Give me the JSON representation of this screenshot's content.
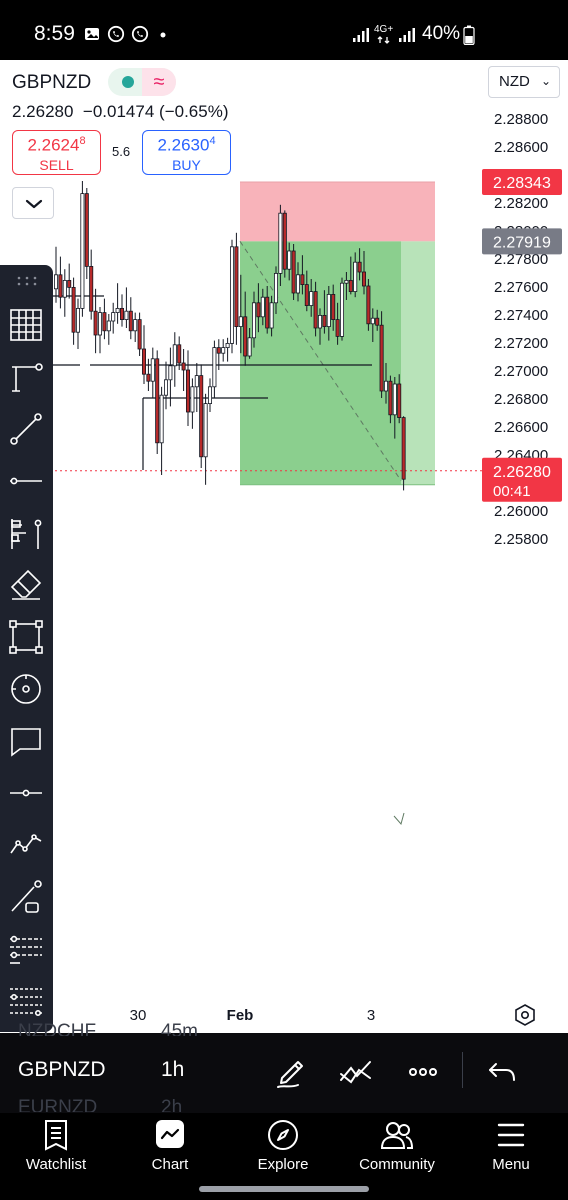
{
  "status_bar": {
    "time": "8:59",
    "network": "4G+",
    "battery": "40%",
    "icons": [
      "gallery-icon",
      "whatsapp-icon",
      "whatsapp-icon",
      "dot-icon",
      "signal-icon",
      "signal-icon",
      "battery-icon"
    ]
  },
  "header": {
    "symbol": "GBPNZD",
    "price": "2.26280",
    "change": "−0.01474",
    "change_pct": "(−0.65%)",
    "sell": {
      "price": "2.2624",
      "price_sup": "8",
      "label": "SELL"
    },
    "buy": {
      "price": "2.2630",
      "price_sup": "4",
      "label": "BUY"
    },
    "spread": "5.6",
    "currency": "NZD"
  },
  "chart_data": {
    "type": "candlestick",
    "price_axis": [
      "2.28800",
      "2.28600",
      "2.28400",
      "2.28200",
      "2.28000",
      "2.27800",
      "2.27600",
      "2.27400",
      "2.27200",
      "2.27000",
      "2.26800",
      "2.26600",
      "2.26400",
      "2.26200",
      "2.26000",
      "2.25800"
    ],
    "time_axis": [
      "30",
      "Feb",
      "3"
    ],
    "price_labels": [
      {
        "value": "2.28343",
        "color": "#f23645"
      },
      {
        "value": "2.27919",
        "color": "#787b86"
      },
      {
        "value": "2.26280",
        "countdown": "00:41",
        "color": "#f23645"
      }
    ],
    "position": {
      "type": "short",
      "entry": 2.27919,
      "stop": 2.28343,
      "target": 2.2618
    },
    "ylim": [
      2.257,
      2.289
    ],
    "candles": [
      [
        2.2758,
        2.2788,
        2.2748,
        2.2768
      ],
      [
        2.2768,
        2.2781,
        2.2744,
        2.2752
      ],
      [
        2.2752,
        2.2772,
        2.2738,
        2.2764
      ],
      [
        2.2764,
        2.2776,
        2.2751,
        2.2759
      ],
      [
        2.2759,
        2.2766,
        2.2718,
        2.2727
      ],
      [
        2.2727,
        2.2751,
        2.2715,
        2.2744
      ],
      [
        2.2744,
        2.2835,
        2.2738,
        2.2826
      ],
      [
        2.2826,
        2.283,
        2.2765,
        2.2774
      ],
      [
        2.2774,
        2.2786,
        2.2736,
        2.2742
      ],
      [
        2.2742,
        2.2758,
        2.2712,
        2.2725
      ],
      [
        2.2725,
        2.2745,
        2.2712,
        2.2741
      ],
      [
        2.2741,
        2.2751,
        2.2722,
        2.2728
      ],
      [
        2.2728,
        2.274,
        2.2718,
        2.2735
      ],
      [
        2.2735,
        2.2748,
        2.2726,
        2.2741
      ],
      [
        2.2741,
        2.2762,
        2.2733,
        2.2744
      ],
      [
        2.2744,
        2.2754,
        2.2731,
        2.2736
      ],
      [
        2.2736,
        2.2759,
        2.273,
        2.2742
      ],
      [
        2.2742,
        2.2752,
        2.2722,
        2.2728
      ],
      [
        2.2728,
        2.2741,
        2.272,
        2.2736
      ],
      [
        2.2736,
        2.2741,
        2.271,
        2.2715
      ],
      [
        2.2715,
        2.2732,
        2.269,
        2.2697
      ],
      [
        2.2697,
        2.2708,
        2.2685,
        2.2692
      ],
      [
        2.2692,
        2.2716,
        2.268,
        2.2708
      ],
      [
        2.2708,
        2.2714,
        2.264,
        2.2648
      ],
      [
        2.2648,
        2.2688,
        2.2625,
        2.2682
      ],
      [
        2.2682,
        2.2706,
        2.2672,
        2.2693
      ],
      [
        2.2693,
        2.2716,
        2.2674,
        2.2703
      ],
      [
        2.2703,
        2.2727,
        2.2688,
        2.2718
      ],
      [
        2.2718,
        2.2724,
        2.27,
        2.2705
      ],
      [
        2.2705,
        2.2715,
        2.2685,
        2.27
      ],
      [
        2.27,
        2.2714,
        2.266,
        2.267
      ],
      [
        2.267,
        2.2694,
        2.2658,
        2.2688
      ],
      [
        2.2688,
        2.2705,
        2.267,
        2.2696
      ],
      [
        2.2696,
        2.2704,
        2.263,
        2.2638
      ],
      [
        2.2638,
        2.2683,
        2.2618,
        2.2676
      ],
      [
        2.2676,
        2.2694,
        2.267,
        2.2688
      ],
      [
        2.2688,
        2.2721,
        2.268,
        2.2716
      ],
      [
        2.2716,
        2.2722,
        2.27,
        2.2712
      ],
      [
        2.2712,
        2.2722,
        2.2706,
        2.2716
      ],
      [
        2.2716,
        2.2723,
        2.2706,
        2.2719
      ],
      [
        2.2719,
        2.2793,
        2.2712,
        2.2788
      ],
      [
        2.2788,
        2.2798,
        2.2718,
        2.2731
      ],
      [
        2.2731,
        2.2768,
        2.2712,
        2.2738
      ],
      [
        2.2738,
        2.2756,
        2.2703,
        2.271
      ],
      [
        2.271,
        2.273,
        2.2708,
        2.2723
      ],
      [
        2.2723,
        2.2756,
        2.2716,
        2.2748
      ],
      [
        2.2748,
        2.2762,
        2.2727,
        2.2738
      ],
      [
        2.2738,
        2.2758,
        2.2732,
        2.2752
      ],
      [
        2.2752,
        2.276,
        2.2726,
        2.273
      ],
      [
        2.273,
        2.2753,
        2.2724,
        2.2748
      ],
      [
        2.2748,
        2.2774,
        2.274,
        2.2769
      ],
      [
        2.2769,
        2.2818,
        2.276,
        2.2812
      ],
      [
        2.2812,
        2.2814,
        2.2766,
        2.2772
      ],
      [
        2.2772,
        2.2791,
        2.2764,
        2.2785
      ],
      [
        2.2785,
        2.279,
        2.275,
        2.2755
      ],
      [
        2.2755,
        2.2777,
        2.2749,
        2.2768
      ],
      [
        2.2768,
        2.2782,
        2.2754,
        2.2761
      ],
      [
        2.2761,
        2.2771,
        2.2742,
        2.2746
      ],
      [
        2.2746,
        2.2765,
        2.2738,
        2.2756
      ],
      [
        2.2756,
        2.2763,
        2.2724,
        2.273
      ],
      [
        2.273,
        2.2744,
        2.2718,
        2.2739
      ],
      [
        2.2739,
        2.2757,
        2.2726,
        2.2731
      ],
      [
        2.2731,
        2.276,
        2.2721,
        2.2754
      ],
      [
        2.2754,
        2.2761,
        2.2728,
        2.2736
      ],
      [
        2.2736,
        2.2748,
        2.2718,
        2.2724
      ],
      [
        2.2724,
        2.2766,
        2.2721,
        2.2762
      ],
      [
        2.2762,
        2.277,
        2.275,
        2.2764
      ],
      [
        2.2764,
        2.2781,
        2.2754,
        2.2756
      ],
      [
        2.2756,
        2.2784,
        2.2752,
        2.2777
      ],
      [
        2.2777,
        2.2787,
        2.2764,
        2.277
      ],
      [
        2.277,
        2.2785,
        2.2754,
        2.276
      ],
      [
        2.276,
        2.2765,
        2.2728,
        2.2733
      ],
      [
        2.2733,
        2.2744,
        2.272,
        2.2737
      ],
      [
        2.2737,
        2.2743,
        2.2728,
        2.2732
      ],
      [
        2.2732,
        2.2742,
        2.268,
        2.2685
      ],
      [
        2.2685,
        2.2705,
        2.2676,
        2.2692
      ],
      [
        2.2692,
        2.2696,
        2.2662,
        2.2668
      ],
      [
        2.2668,
        2.2695,
        2.2651,
        2.269
      ],
      [
        2.269,
        2.2697,
        2.2662,
        2.2666
      ],
      [
        2.2666,
        2.2667,
        2.2614,
        2.2622
      ]
    ]
  },
  "drawing_tools": [
    "grid-icon",
    "anchor-line-icon",
    "trend-line-icon",
    "horizontal-line-icon",
    "fib-tool-icon",
    "eraser-icon",
    "rectangle-icon",
    "target-icon",
    "comment-icon",
    "horizontal-ray-icon",
    "pattern-icon",
    "line-box-icon",
    "levels-icon",
    "measure-levels-icon"
  ],
  "bottom_strip": {
    "prev_symbol": "NZDCHF",
    "prev_interval": "45m",
    "symbol": "GBPNZD",
    "interval": "1h",
    "next_symbol": "EURNZD",
    "next_interval": "2h",
    "icons": [
      "pencil-icon",
      "indicator-icon",
      "more-icon",
      "undo-icon"
    ]
  },
  "nav": {
    "items": [
      {
        "label": "Watchlist",
        "icon": "list-icon"
      },
      {
        "label": "Chart",
        "icon": "chart-icon"
      },
      {
        "label": "Explore",
        "icon": "compass-icon"
      },
      {
        "label": "Community",
        "icon": "people-icon"
      },
      {
        "label": "Menu",
        "icon": "hamburger-icon"
      }
    ]
  },
  "colors": {
    "up": "#ffffff",
    "down": "#b72a2a",
    "stop_zone": "#f8b3ba",
    "target_zone": "#8bcf8e",
    "target_zone_light": "#b8e3b9",
    "price_line": "#f23645"
  }
}
